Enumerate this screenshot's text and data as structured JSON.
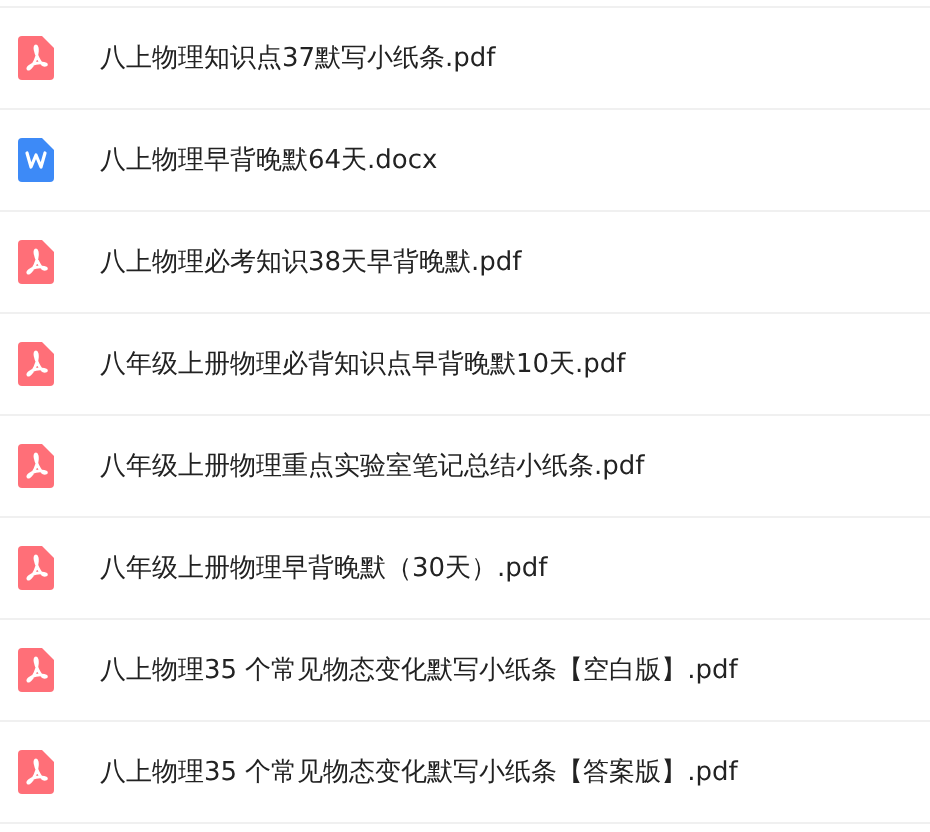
{
  "files": [
    {
      "kind": "pdf",
      "name": "八上物理知识点37默写小纸条.pdf"
    },
    {
      "kind": "docx",
      "name": "八上物理早背晚默64天.docx"
    },
    {
      "kind": "pdf",
      "name": "八上物理必考知识38天早背晚默.pdf"
    },
    {
      "kind": "pdf",
      "name": "八年级上册物理必背知识点早背晚默10天.pdf"
    },
    {
      "kind": "pdf",
      "name": "八年级上册物理重点实验室笔记总结小纸条.pdf"
    },
    {
      "kind": "pdf",
      "name": "八年级上册物理早背晚默（30天）.pdf"
    },
    {
      "kind": "pdf",
      "name": "八上物理35 个常见物态变化默写小纸条【空白版】.pdf"
    },
    {
      "kind": "pdf",
      "name": "八上物理35 个常见物态变化默写小纸条【答案版】.pdf"
    }
  ]
}
